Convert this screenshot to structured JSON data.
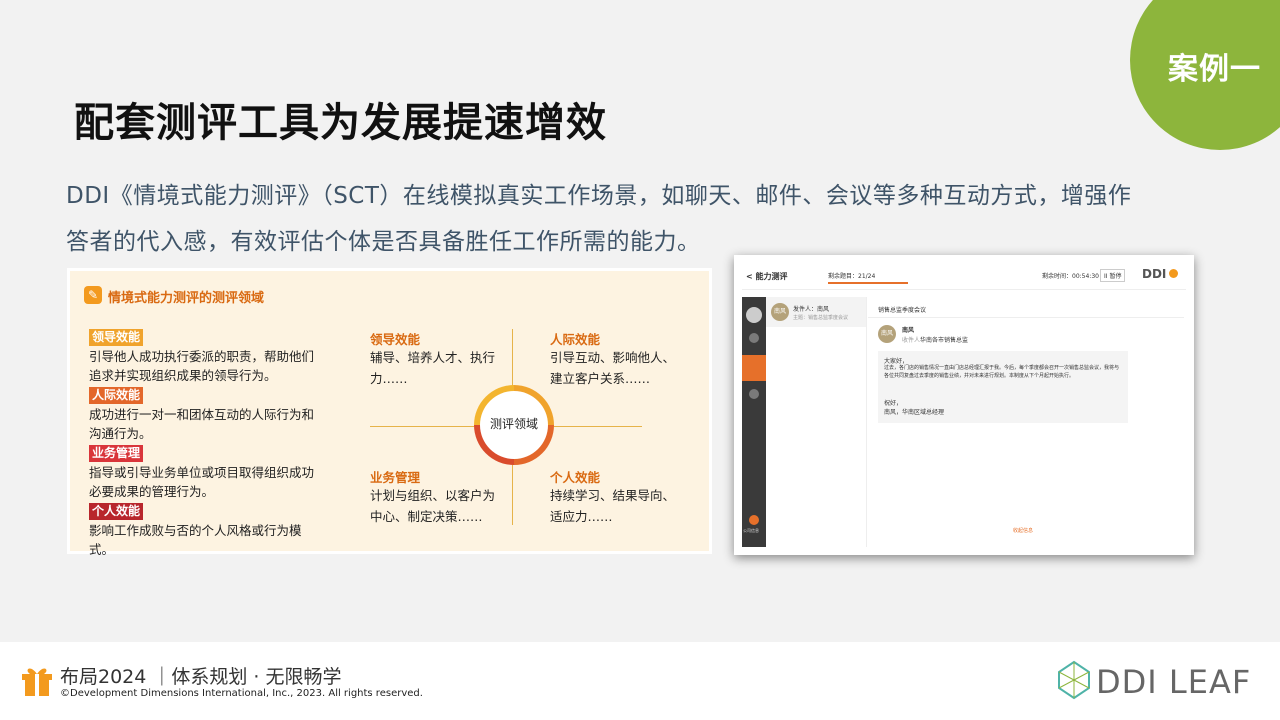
{
  "badge": {
    "label": "案例一",
    "color": "#8db53c"
  },
  "title": "配套测评工具为发展提速增效",
  "intro": {
    "line1": "DDI《情境式能力测评》（SCT）在线模拟真实工作场景，如聊天、邮件、会议等多种互动方式，增强作",
    "line2": "答者的代入感，有效评估个体是否具备胜任工作所需的能力。"
  },
  "panel": {
    "title": "情境式能力测评的测评领域",
    "items": [
      {
        "tag": "领导效能",
        "color": "#f0a32c",
        "desc": "引导他人成功执行委派的职责，帮助他们追求并实现组织成果的领导行为。"
      },
      {
        "tag": "人际效能",
        "color": "#e3672a",
        "desc": "成功进行一对一和团体互动的人际行为和沟通行为。"
      },
      {
        "tag": "业务管理",
        "color": "#d9353a",
        "desc": "指导或引导业务单位或项目取得组织成功必要成果的管理行为。"
      },
      {
        "tag": "个人效能",
        "color": "#b8262c",
        "desc": "影响工作成败与否的个人风格或行为模式。"
      }
    ],
    "quadrants": {
      "tl": {
        "title": "领导效能",
        "desc": "辅导、培养人才、执行力……"
      },
      "tr": {
        "title": "人际效能",
        "desc": "引导互动、影响他人、建立客户关系……"
      },
      "bl": {
        "title": "业务管理",
        "desc": "计划与组织、以客户为中心、制定决策……"
      },
      "br": {
        "title": "个人效能",
        "desc": "持续学习、结果导向、适应力……"
      }
    },
    "center": "测评领域"
  },
  "screenshot": {
    "back": "< 能力测评",
    "progress": "剩余题目：21/24",
    "time": "剩余时间：00:54:30",
    "pause": "II 暂停",
    "logo": "DDI",
    "sender": "发件人：南风",
    "sender_sub": "主题：销售总监季度会议",
    "subject": "销售总监季度会议",
    "from_name": "南风",
    "to_label": "收件人：",
    "to_value": "华南各市销售总监",
    "body": [
      "大家好，",
      "过去，各门店的销售情况一直由门店总经理汇报于我。今后，每个季度都会召开一次销售总监会议，我将与各位共同复盘过去季度的销售业绩，并对未来进行规划。本制度从下个月起开始执行。",
      "祝好，",
      "南风，华南区域总经理"
    ],
    "avatar_label": "南风",
    "sidebar_bottom": "公司信息",
    "collapse": "收起信息"
  },
  "footer": {
    "title": "布局2024 ｜体系规划 · 无限畅学",
    "copyright": "©Development Dimensions International, Inc., 2023. All rights reserved.",
    "logo": "DDI LEAF"
  }
}
